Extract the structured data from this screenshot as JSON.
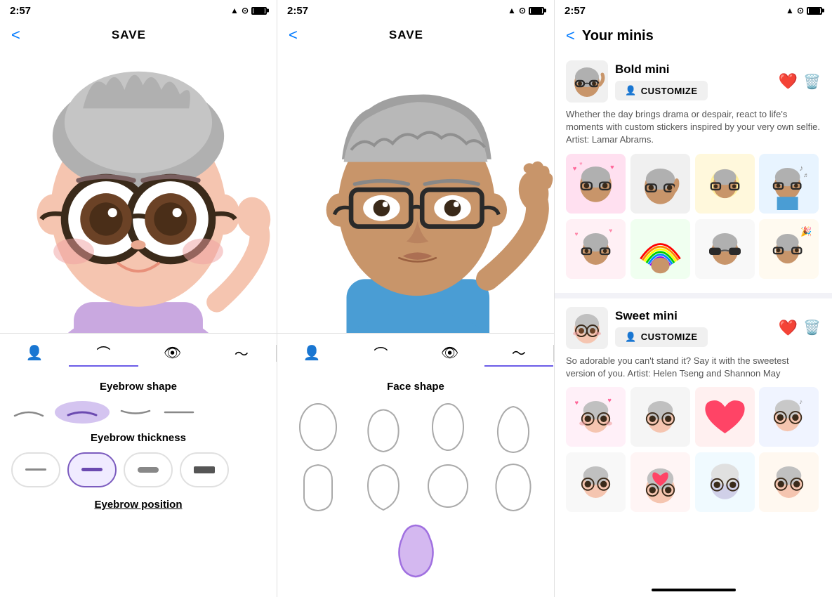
{
  "panel1": {
    "status": {
      "time": "2:57",
      "signal": "▲",
      "wifi": "WiFi",
      "battery": "100"
    },
    "nav": {
      "back": "<",
      "save": "SAVE"
    },
    "toolbar_items": [
      {
        "icon": "👤",
        "label": "body"
      },
      {
        "icon": "⌒",
        "label": "brow"
      },
      {
        "icon": "👁",
        "label": "eye"
      },
      {
        "icon": "〜",
        "label": "wave"
      }
    ],
    "sections": [
      {
        "title": "Eyebrow shape",
        "options": [
          "〜",
          "▬",
          "〜",
          "〜"
        ]
      },
      {
        "title": "Eyebrow thickness",
        "options_thickness": [
          "—",
          "—",
          "—",
          "■"
        ]
      },
      {
        "title": "Eyebrow position"
      }
    ]
  },
  "panel2": {
    "status": {
      "time": "2:57"
    },
    "nav": {
      "back": "<",
      "save": "SAVE"
    },
    "toolbar_items": [
      {
        "icon": "👤",
        "label": "body"
      },
      {
        "icon": "⌒",
        "label": "brow"
      },
      {
        "icon": "👁",
        "label": "eye"
      },
      {
        "icon": "〜",
        "label": "wave"
      }
    ],
    "sections": [
      {
        "title": "Face shape"
      }
    ]
  },
  "panel3": {
    "status": {
      "time": "2:57"
    },
    "title": "Your minis",
    "back": "<",
    "minis": [
      {
        "name": "Bold mini",
        "customize_label": "CUSTOMIZE",
        "description": "Whether the day brings drama or despair, react to life's moments with custom stickers inspired by your very own selfie. Artist: Lamar Abrams.",
        "stickers": [
          "😤",
          "🤔",
          "✨",
          "🎵"
        ]
      },
      {
        "name": "Sweet mini",
        "customize_label": "CUSTOMIZE",
        "description": "So adorable you can't stand it? Say it with the sweetest version of you. Artist: Helen Tseng and Shannon May",
        "stickers": [
          "😍",
          "🤓",
          "❤️",
          "🎵"
        ]
      }
    ]
  }
}
